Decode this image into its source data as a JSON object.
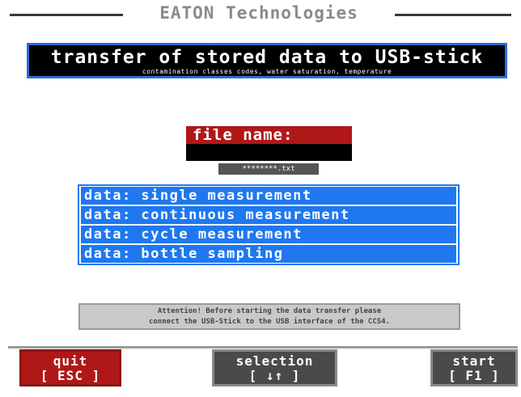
{
  "app": {
    "title": "EATON Technologies"
  },
  "banner": {
    "title": "transfer of stored data to USB-stick",
    "subtitle": "contamination classes codes, water saturation, temperature"
  },
  "file": {
    "label": "file name:",
    "value": "",
    "hint": "********.txt"
  },
  "menu": {
    "items": [
      {
        "label": "data: single measurement"
      },
      {
        "label": "data: continuous measurement"
      },
      {
        "label": "data: cycle measurement"
      },
      {
        "label": "data: bottle sampling"
      }
    ]
  },
  "notice": {
    "line1": "Attention! Before starting the data transfer please",
    "line2": "connect the USB-Stick to the USB interface of the CCS4."
  },
  "fkeys": {
    "quit": {
      "label": "quit",
      "key": "[ ESC ]"
    },
    "selection": {
      "label": "selection",
      "key": "[ ↓↑ ]"
    },
    "start": {
      "label": "start",
      "key": "[ F1 ]"
    }
  },
  "colors": {
    "accent": "#1f78f0",
    "danger": "#b01818",
    "banner_bg": "#000000",
    "key_bg": "#4a4a4a"
  }
}
